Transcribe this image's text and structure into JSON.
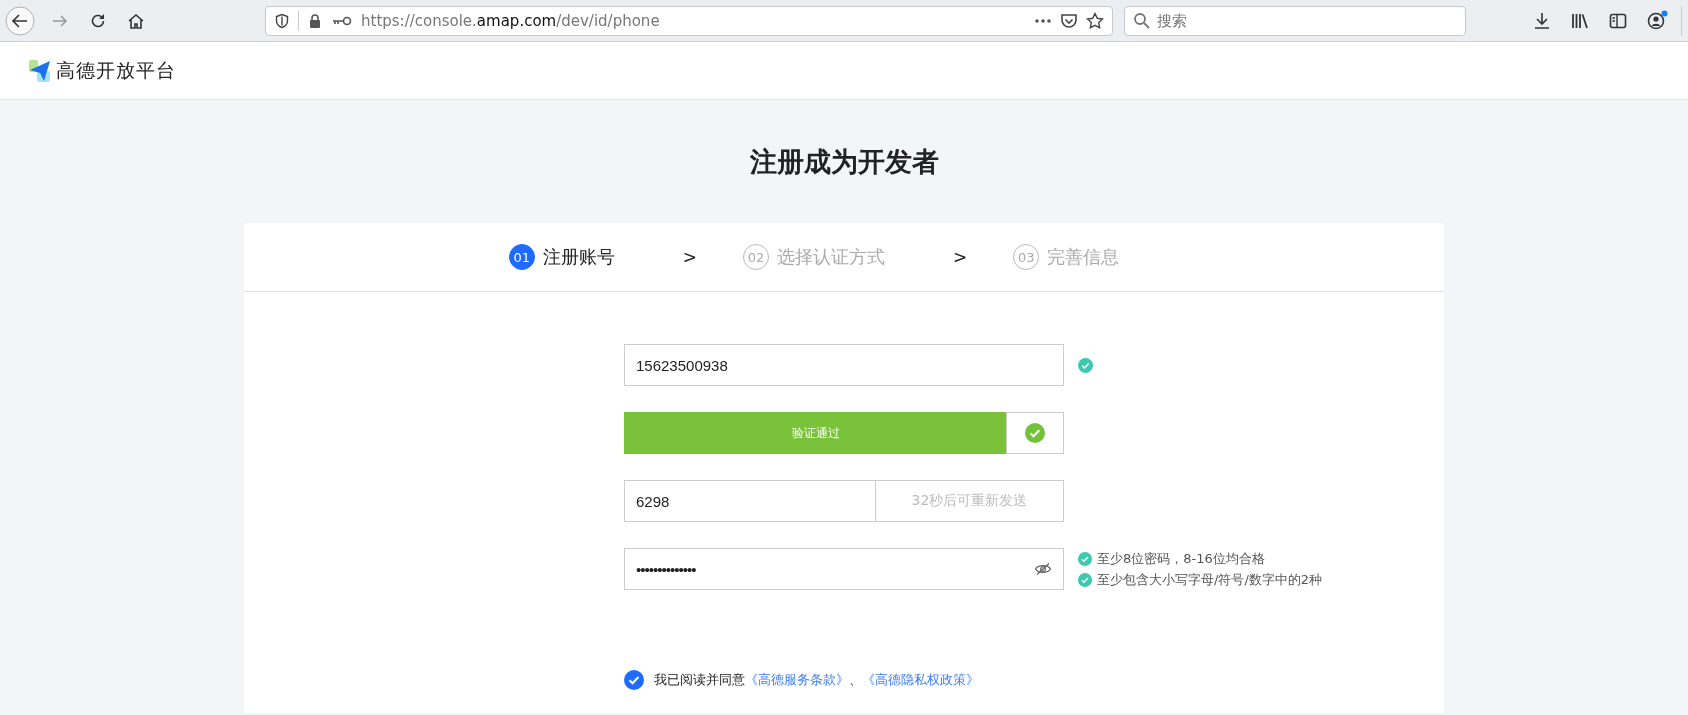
{
  "browser": {
    "url_prefix": "https://console.",
    "url_domain": "amap.com",
    "url_path": "/dev/id/phone",
    "search": {
      "placeholder": "搜索"
    },
    "account_badge": true
  },
  "site": {
    "logo_text": "高德开放平台"
  },
  "page_title": "注册成为开发者",
  "steps": [
    {
      "number": "01",
      "label": "注册账号",
      "selected": true
    },
    {
      "number": "02",
      "label": "选择认证方式",
      "selected": false
    },
    {
      "number": "03",
      "label": "完善信息",
      "selected": false
    }
  ],
  "step_separator": ">",
  "form": {
    "phone": {
      "value": "15623500938",
      "valid": true
    },
    "slider_verify": {
      "label": "验证通过",
      "verified": true
    },
    "sms_code": {
      "value": "6298",
      "resend": "32秒后可重新发送",
      "resend_disabled": true
    },
    "password": {
      "value": "••••••••••••••",
      "hints": [
        {
          "text": "至少8位密码，8-16位均合格",
          "met": true
        },
        {
          "text": "至少包含大小写字母/符号/数字中的2种",
          "met": true
        }
      ]
    },
    "agreement": {
      "checked": true,
      "text": "我已阅读并同意",
      "links": [
        "《高德服务条款》",
        "《高德隐私权政策》"
      ],
      "separator": "、"
    }
  }
}
